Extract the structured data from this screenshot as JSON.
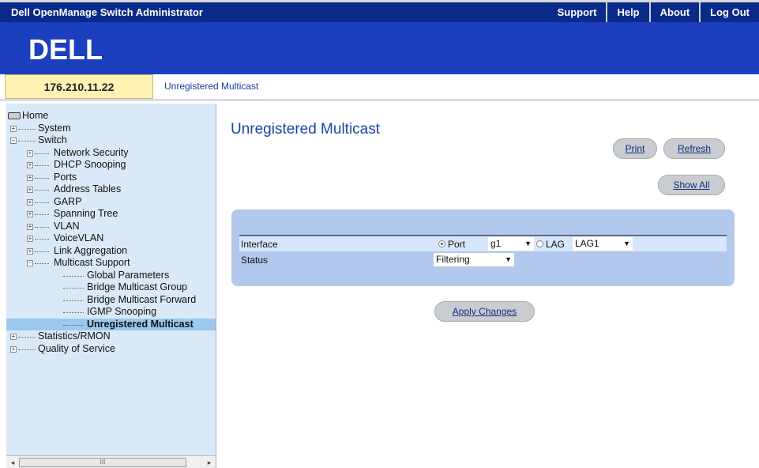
{
  "app_title": "Dell OpenManage Switch Administrator",
  "top_links": [
    "Support",
    "Help",
    "About",
    "Log Out"
  ],
  "logo_text": "DELL",
  "ip_address": "176.210.11.22",
  "breadcrumb": "Unregistered Multicast",
  "tree": {
    "home": "Home",
    "system": "System",
    "switch": "Switch",
    "network_security": "Network Security",
    "dhcp_snooping": "DHCP Snooping",
    "ports": "Ports",
    "address_tables": "Address Tables",
    "garp": "GARP",
    "spanning_tree": "Spanning Tree",
    "vlan": "VLAN",
    "voicevlan": "VoiceVLAN",
    "link_aggregation": "Link Aggregation",
    "multicast_support": "Multicast Support",
    "global_parameters": "Global Parameters",
    "bridge_multicast_group": "Bridge Multicast Group",
    "bridge_multicast_forward": "Bridge Multicast Forward",
    "igmp_snooping": "IGMP Snooping",
    "unregistered_multicast": "Unregistered Multicast",
    "statistics_rmon": "Statistics/RMON",
    "quality_of_service": "Quality of Service"
  },
  "scrollbar_grip": "III",
  "page_title": "Unregistered Multicast",
  "buttons": {
    "print": "Print",
    "refresh": "Refresh",
    "show_all": "Show All",
    "apply_changes": "Apply Changes"
  },
  "form": {
    "interface_label": "Interface",
    "port_label": "Port",
    "port_value": "g1",
    "lag_label": "LAG",
    "lag_value": "LAG1",
    "status_label": "Status",
    "status_value": "Filtering"
  },
  "colors": {
    "top_bar": "#0a2a8a",
    "logo_band": "#1b3fbd",
    "sidebar": "#d9e9f7",
    "panel": "#b2c8ec",
    "title": "#1b46a8"
  }
}
